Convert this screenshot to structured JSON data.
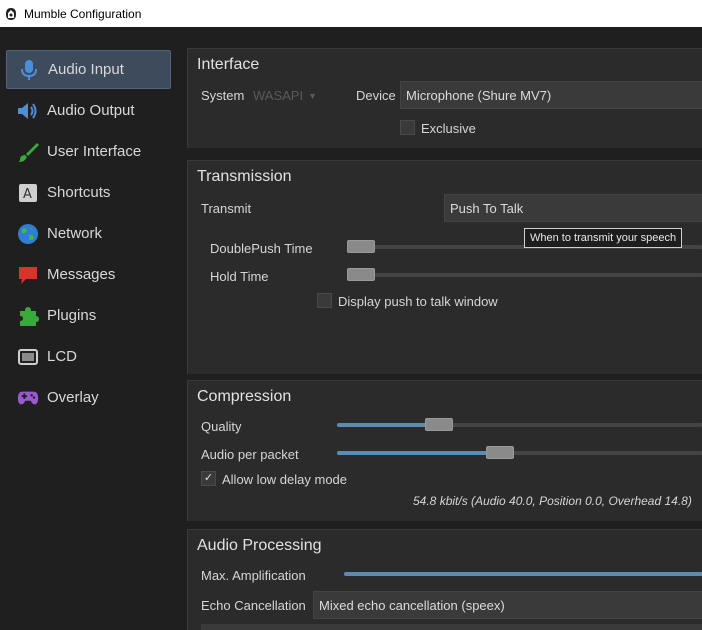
{
  "window": {
    "title": "Mumble Configuration",
    "icon": "mumble-icon"
  },
  "sidebar": {
    "items": [
      {
        "label": "Audio Input",
        "icon": "microphone-icon",
        "active": true
      },
      {
        "label": "Audio Output",
        "icon": "speaker-icon"
      },
      {
        "label": "User Interface",
        "icon": "brush-icon"
      },
      {
        "label": "Shortcuts",
        "icon": "keyboard-key-icon"
      },
      {
        "label": "Network",
        "icon": "globe-icon"
      },
      {
        "label": "Messages",
        "icon": "speech-bubble-icon"
      },
      {
        "label": "Plugins",
        "icon": "puzzle-icon"
      },
      {
        "label": "LCD",
        "icon": "lcd-display-icon"
      },
      {
        "label": "Overlay",
        "icon": "gamepad-icon"
      }
    ]
  },
  "interface": {
    "title": "Interface",
    "system_label": "System",
    "system_value": "WASAPI",
    "device_label": "Device",
    "device_value": "Microphone (Shure MV7)",
    "exclusive_label": "Exclusive",
    "exclusive_checked": false
  },
  "transmission": {
    "title": "Transmission",
    "transmit_label": "Transmit",
    "transmit_value": "Push To Talk",
    "tooltip": "When to transmit your speech",
    "doublepush_label": "DoublePush Time",
    "doublepush_level": 0,
    "hold_label": "Hold Time",
    "hold_level": 0,
    "display_ptt_label": "Display push to talk window",
    "display_ptt_checked": false
  },
  "compression": {
    "title": "Compression",
    "quality_label": "Quality",
    "quality_level": 0.26,
    "app_label": "Audio per packet",
    "app_level": 0.44,
    "low_delay_label": "Allow low delay mode",
    "low_delay_checked": true,
    "bitrate_text": "54.8 kbit/s (Audio 40.0, Position 0.0, Overhead 14.8)"
  },
  "processing": {
    "title": "Audio Processing",
    "max_amp_label": "Max. Amplification",
    "max_amp_level": 1.0,
    "echo_label": "Echo Cancellation",
    "echo_value": "Mixed echo cancellation (speex)"
  }
}
